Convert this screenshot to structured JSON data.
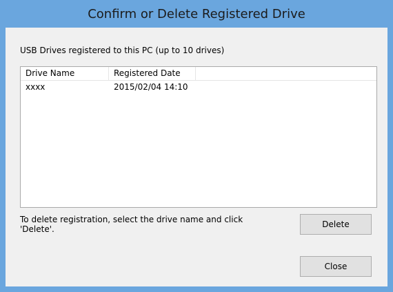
{
  "window": {
    "title": "Confirm or Delete Registered Drive"
  },
  "caption": "USB Drives registered to this PC (up to 10 drives)",
  "list": {
    "columns": [
      "Drive Name",
      "Registered Date"
    ],
    "rows": [
      {
        "drive_name": "xxxx",
        "registered_date": "2015/02/04 14:10"
      }
    ]
  },
  "instruction": "To delete registration, select the drive name and click 'Delete'.",
  "buttons": {
    "delete_label": "Delete",
    "close_label": "Close"
  },
  "colors": {
    "titlebar": "#6aa6de",
    "client_background": "#f0f0f0",
    "button_face": "#e1e1e1"
  }
}
